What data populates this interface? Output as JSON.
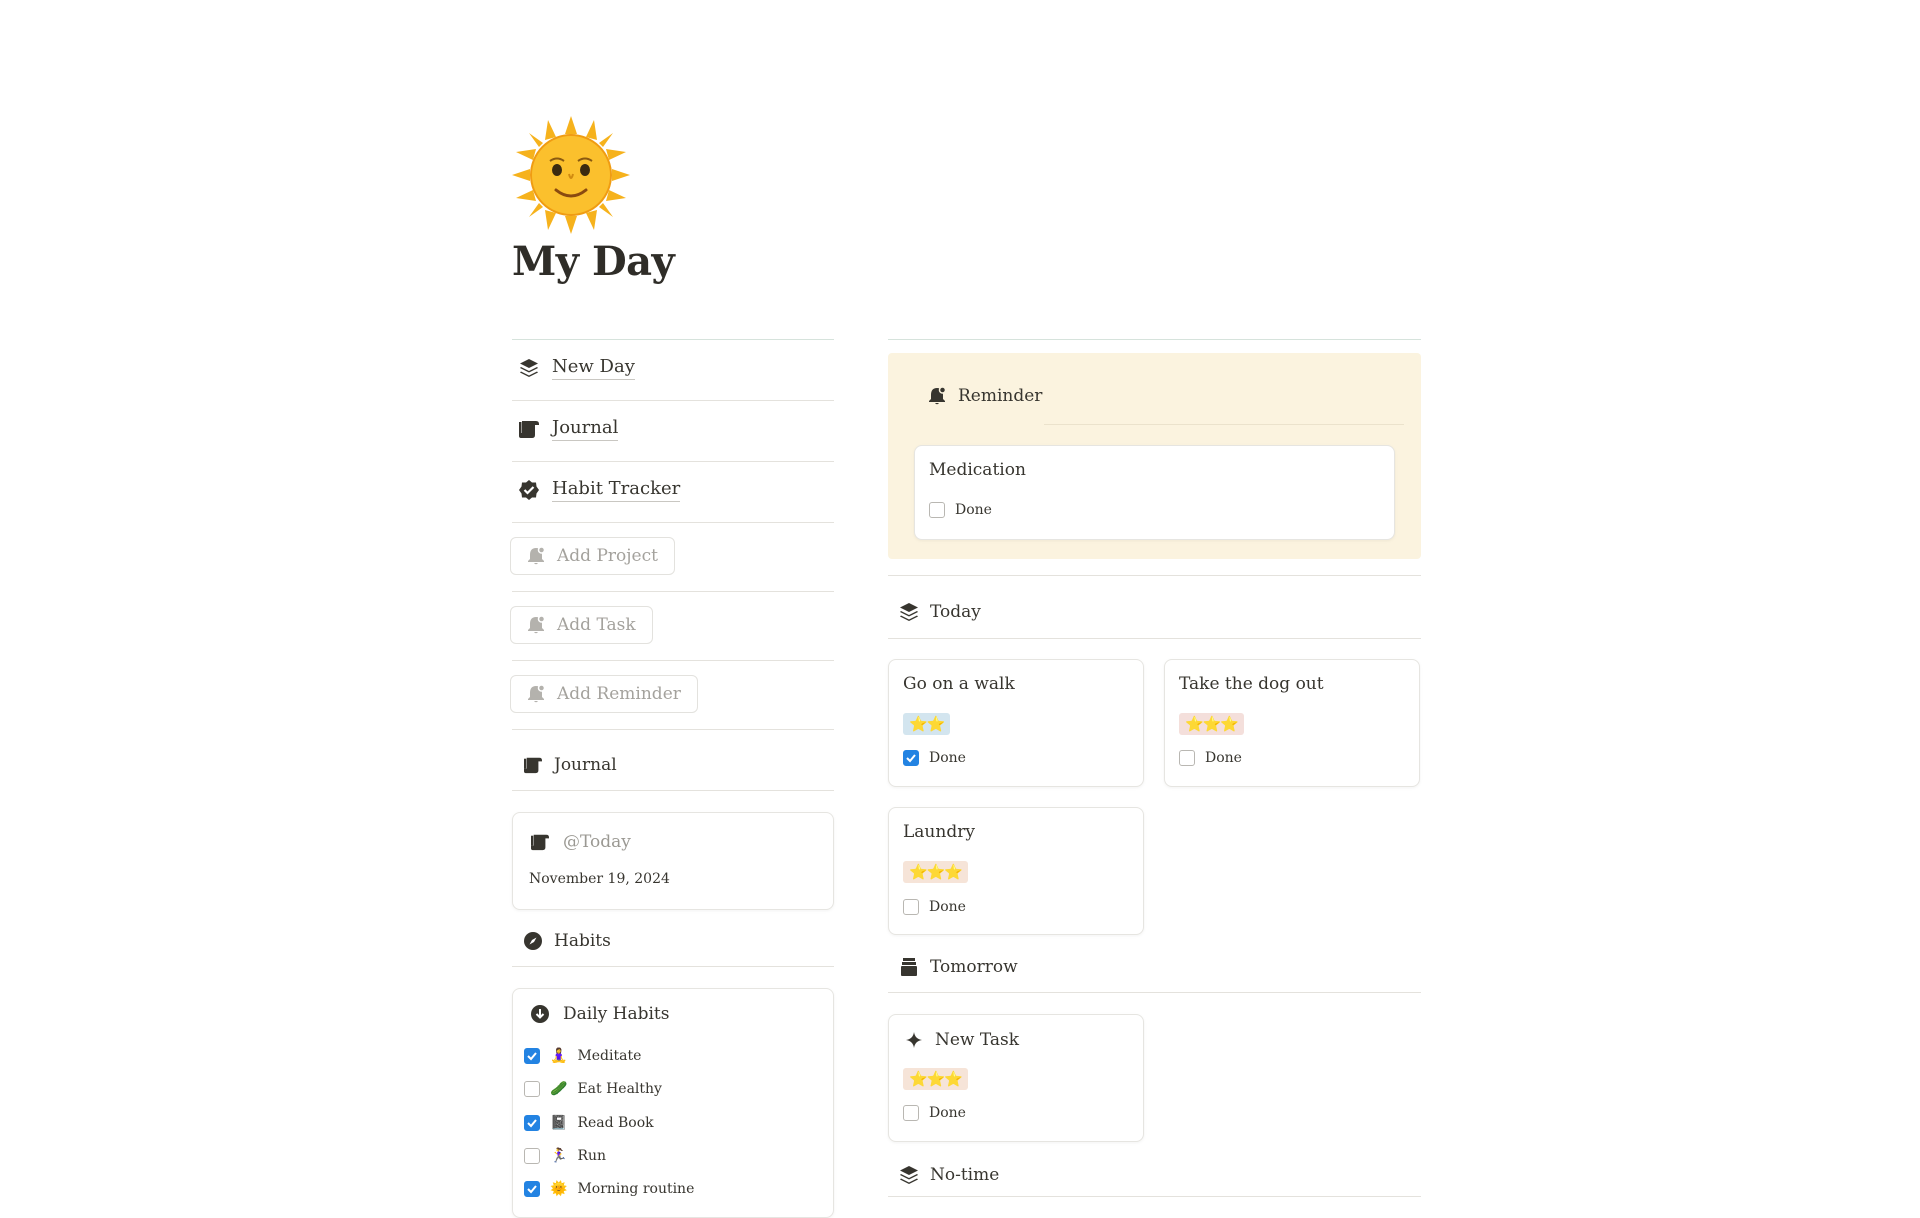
{
  "page": {
    "title": "My Day",
    "icon": "sun-with-face-icon"
  },
  "nav": [
    {
      "label": "New Day",
      "icon": "layers-icon"
    },
    {
      "label": "Journal",
      "icon": "scroll-icon"
    },
    {
      "label": "Habit Tracker",
      "icon": "verified-badge-icon"
    }
  ],
  "buttons": [
    {
      "label": "Add Project",
      "icon": "bell-icon"
    },
    {
      "label": "Add Task",
      "icon": "bell-icon"
    },
    {
      "label": "Add Reminder",
      "icon": "bell-icon"
    }
  ],
  "journal": {
    "heading": "Journal",
    "card_title": "@Today",
    "card_date": "November 19, 2024"
  },
  "habits": {
    "heading": "Habits",
    "card_title": "Daily Habits",
    "items": [
      {
        "emoji": "🧘‍♀️",
        "label": "Meditate",
        "checked": true
      },
      {
        "emoji": "🥒",
        "label": "Eat Healthy",
        "checked": false
      },
      {
        "emoji": "📓",
        "label": "Read Book",
        "checked": true
      },
      {
        "emoji": "🏃‍♀️",
        "label": "Run",
        "checked": false
      },
      {
        "emoji": "🌞",
        "label": "Morning routine",
        "checked": true
      }
    ]
  },
  "reminder": {
    "heading": "Reminder",
    "card_title": "Medication",
    "done_label": "Done",
    "done": false
  },
  "today": {
    "heading": "Today",
    "tasks": [
      {
        "title": "Go on a walk",
        "stars": "⭐⭐",
        "star_count": 2,
        "done_label": "Done",
        "done": true,
        "tag_color": "#d3e5ef"
      },
      {
        "title": "Take the dog out",
        "stars": "⭐⭐⭐",
        "star_count": 3,
        "done_label": "Done",
        "done": false,
        "tag_color": "#f4dfdb"
      },
      {
        "title": "Laundry",
        "stars": "⭐⭐⭐",
        "star_count": 3,
        "done_label": "Done",
        "done": false,
        "tag_color": "#f6e4d8"
      }
    ]
  },
  "tomorrow": {
    "heading": "Tomorrow",
    "tasks": [
      {
        "title": "New Task",
        "stars": "⭐⭐⭐",
        "star_count": 3,
        "done_label": "Done",
        "done": false,
        "tag_color": "#f6e4d8"
      }
    ]
  },
  "notime": {
    "heading": "No-time"
  },
  "colors": {
    "accent": "#2383e2",
    "reminder_bg": "#fbf3df",
    "text": "#37352f",
    "muted": "#a4a29d"
  }
}
